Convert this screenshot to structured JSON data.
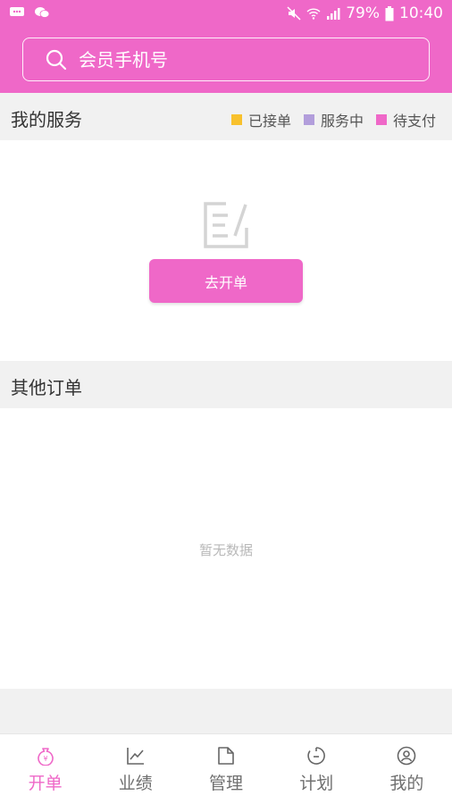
{
  "status_bar": {
    "battery": "79%",
    "time": "10:40"
  },
  "search": {
    "placeholder": "会员手机号"
  },
  "my_service": {
    "title": "我的服务",
    "legend": [
      {
        "label": "已接单",
        "color": "#f8c12d"
      },
      {
        "label": "服务中",
        "color": "#b29edb"
      },
      {
        "label": "待支付",
        "color": "#ef68c8"
      }
    ],
    "button_label": "去开单"
  },
  "other_orders": {
    "title": "其他订单",
    "empty_text": "暂无数据"
  },
  "bottom_nav": {
    "items": [
      {
        "label": "开单",
        "icon": "money-bag-icon",
        "active": true
      },
      {
        "label": "业绩",
        "icon": "chart-icon",
        "active": false
      },
      {
        "label": "管理",
        "icon": "document-icon",
        "active": false
      },
      {
        "label": "计划",
        "icon": "timer-icon",
        "active": false
      },
      {
        "label": "我的",
        "icon": "user-icon",
        "active": false
      }
    ]
  },
  "colors": {
    "brand": "#ef68c8",
    "background": "#f1f1f1"
  }
}
